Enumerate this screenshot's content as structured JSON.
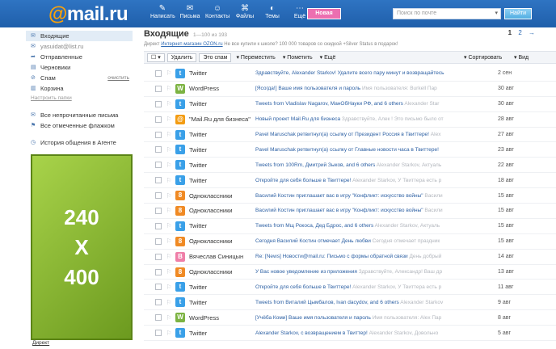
{
  "app": {
    "logo_at": "@",
    "logo_text": "mail.ru"
  },
  "topnav": {
    "items": [
      {
        "label": "Написать",
        "icon": "✎"
      },
      {
        "label": "Письма",
        "icon": "✉"
      },
      {
        "label": "Контакты",
        "icon": "☺"
      },
      {
        "label": "Файлы",
        "icon": "⌘"
      },
      {
        "label": "Темы",
        "icon": "◐"
      },
      {
        "label": "Ещё",
        "icon": "⋯"
      }
    ],
    "new_label": "Новая",
    "search_placeholder": "Поиск по почте",
    "search_dropdown": "▾",
    "find_label": "Найти"
  },
  "sidebar": {
    "folders": [
      {
        "icon": "✉",
        "label": "Входящие",
        "active": true
      },
      {
        "icon": "✉",
        "label": "yasuidat@list.ru",
        "sub": true
      },
      {
        "icon": "➦",
        "label": "Отправленные"
      },
      {
        "icon": "▤",
        "label": "Черновики"
      },
      {
        "icon": "⊘",
        "label": "Спам",
        "clear": "очистить"
      },
      {
        "icon": "▥",
        "label": "Корзина"
      }
    ],
    "settings_label": "Настроить папки",
    "filters": [
      {
        "icon": "✉",
        "label": "Все непрочитанные письма"
      },
      {
        "icon": "⚑",
        "label": "Все отмеченные флажком"
      }
    ],
    "agent_label": "История общения в Агенте",
    "agent_icon": "◷",
    "banner": [
      "240",
      "X",
      "400"
    ],
    "direct_label": "Директ"
  },
  "main": {
    "title": "Входящие",
    "count": "1—100 из 193",
    "pager_current": "1",
    "pager_next": "2",
    "pager_arrow": "→",
    "ad_prefix": "Директ",
    "ad_link": "Интернет-магазин OZON.ru",
    "ad_text": "Не все купили к школе? 100 000 товаров со скидкой +Silver Status в подарок!",
    "toolbar": {
      "select": "☐ ▾",
      "delete": "Удалить",
      "spam": "Это спам",
      "move": "▾ Переместить",
      "mark": "▾ Пометить",
      "more": "▾ Ещё",
      "sort": "▾ Сортировать",
      "view": "▾ Вид"
    }
  },
  "messages": [
    {
      "sender": "Twitter",
      "avatar": "t",
      "color": "#3aa0e8",
      "subject": "Здравствуйте, Alexander Starkov! Удалите всего пару минут и возвращайтесь",
      "preview": "",
      "date": "2 сен"
    },
    {
      "sender": "WordPress",
      "avatar": "W",
      "color": "#7cb342",
      "subject": "[Ясогда!] Ваше имя пользователя и пароль",
      "preview": "Имя пользователя: Burkell Пар",
      "date": "30 авг"
    },
    {
      "sender": "Twitter",
      "avatar": "t",
      "color": "#3aa0e8",
      "subject": "Tweets from Vladislav Nagarov, МанОбНауки РФ, and 6 others",
      "preview": "Alexander Star",
      "date": "30 авг"
    },
    {
      "sender": "\"Mail.Ru для бизнеса\"",
      "avatar": "@",
      "color": "#f39c12",
      "subject": "Новый проект Mail.Ru для бизнеса",
      "preview": "Здравствуйте, Алек ! Это письмо было от",
      "date": "28 авг"
    },
    {
      "sender": "Twitter",
      "avatar": "t",
      "color": "#3aa0e8",
      "subject": "Pavel Maruschak ретвитнул(а) ссылку от Президент Россия в Твиттере!",
      "preview": "Alex",
      "date": "27 авг"
    },
    {
      "sender": "Twitter",
      "avatar": "t",
      "color": "#3aa0e8",
      "subject": "Pavel Maruschak ретвитнул(а) ссылку от Главные новости часа в Твиттере!",
      "preview": "",
      "date": "23 авг"
    },
    {
      "sender": "Twitter",
      "avatar": "t",
      "color": "#3aa0e8",
      "subject": "Tweets from 100Rm, Дмитрий Зыков, and 6 others",
      "preview": "Alexander Starkov, Актуаль",
      "date": "22 авг"
    },
    {
      "sender": "Twitter",
      "avatar": "t",
      "color": "#3aa0e8",
      "subject": "Откройте для себя больше в Твиттере!",
      "preview": "Alexander Starkov, У Твиттера есть р",
      "date": "18 авг"
    },
    {
      "sender": "Одноклассники",
      "avatar": "8",
      "color": "#f08a24",
      "subject": "Василий Костин приглашает вас в игру \"Конфликт: искусство войны\"",
      "preview": "Васили",
      "date": "15 авг"
    },
    {
      "sender": "Одноклассники",
      "avatar": "8",
      "color": "#f08a24",
      "subject": "Василий Костин приглашает вас в игру \"Конфликт: искусство войны\"",
      "preview": "Васили",
      "date": "15 авг"
    },
    {
      "sender": "Twitter",
      "avatar": "t",
      "color": "#3aa0e8",
      "subject": "Tweets from Мщ Рокоса, Дед Бдрос, and 6 others",
      "preview": "Alexander Starkov, Актуаль",
      "date": "15 авг"
    },
    {
      "sender": "Одноклассники",
      "avatar": "8",
      "color": "#f08a24",
      "subject": "Сегодня Василий Костин отмечает День любви",
      "preview": "Сегодня отмечает праздник",
      "date": "15 авг"
    },
    {
      "sender": "Вячеслав Синицын",
      "avatar": "B",
      "color": "#ef7fa8",
      "subject": "Re: [News] Новости@mail.ru: Письмо с формы обратной связи",
      "preview": "День добрый",
      "date": "14 авг"
    },
    {
      "sender": "Одноклассники",
      "avatar": "8",
      "color": "#f08a24",
      "subject": "У Вас новое уведомление из приложения",
      "preview": "Здравствуйте, Александр! Ваш др",
      "date": "13 авг"
    },
    {
      "sender": "Twitter",
      "avatar": "t",
      "color": "#3aa0e8",
      "subject": "Откройте для себя больше в Твиттере!",
      "preview": "Alexander Starkov, У Твиттера есть р",
      "date": "11 авг"
    },
    {
      "sender": "Twitter",
      "avatar": "t",
      "color": "#3aa0e8",
      "subject": "Tweets from Виталий Цымбалов, Ivan dacydov, and 6 others",
      "preview": "Alexander Starkov",
      "date": "9 авг"
    },
    {
      "sender": "WordPress",
      "avatar": "W",
      "color": "#7cb342",
      "subject": "[Учёба Коми] Ваше имя пользователя и пароль",
      "preview": "Имя пользователя: Alex Пар",
      "date": "8 авг"
    },
    {
      "sender": "Twitter",
      "avatar": "t",
      "color": "#3aa0e8",
      "subject": "Alexander Starkov, с возвращением в Твиттер!",
      "preview": "Alexander Starkov, Довольно",
      "date": "5 авг"
    }
  ]
}
